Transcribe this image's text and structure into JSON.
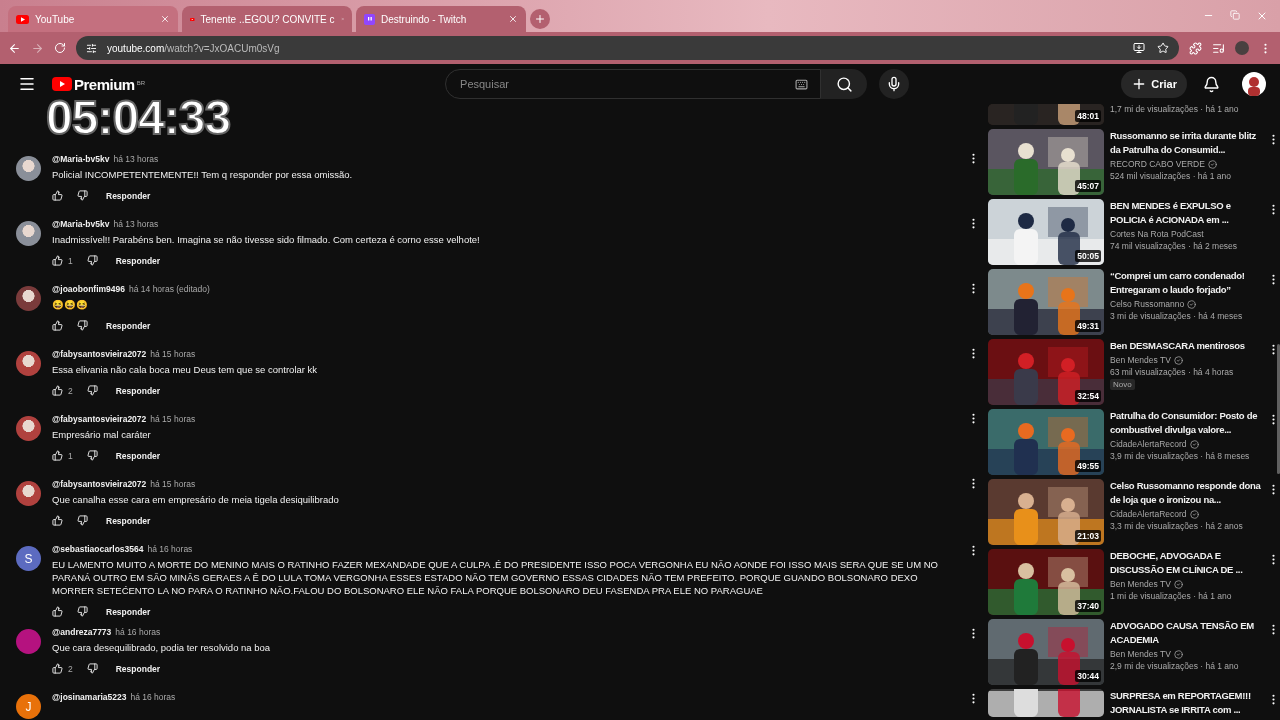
{
  "browser": {
    "tabs": [
      {
        "title": "YouTube",
        "kind": "youtube",
        "selected": true
      },
      {
        "title": "Tenente ..EGOU? CONVITE c",
        "kind": "youtube",
        "selected": false
      },
      {
        "title": "Destruindo - Twitch",
        "kind": "twitch",
        "selected": false
      }
    ],
    "url_host": "youtube.com",
    "url_path": "/watch?v=JxOACUm0sVg"
  },
  "header": {
    "logo": "Premium",
    "region": "BR",
    "search": {
      "placeholder": "Pesquisar"
    },
    "create_label": "Criar"
  },
  "overlay_timer": "05:04:33",
  "comments": [
    {
      "author": "@Maria-bv5kv",
      "time": "há 13 horas",
      "text": "Policial INCOMPETENTEMENTE!! Tem q responder por essa omissão.",
      "reply": "Responder"
    },
    {
      "author": "@Maria-bv5kv",
      "time": "há 13 horas",
      "text": "Inadmissível!! Parabéns ben. Imagina se não tivesse sido filmado. Com certeza é corno esse velhote!",
      "likes": "1",
      "reply": "Responder"
    },
    {
      "author": "@joaobonfim9496",
      "time": "há 14 horas (editado)",
      "text": "😆😆😆",
      "reply": "Responder"
    },
    {
      "author": "@fabysantosvieira2072",
      "time": "há 15 horas",
      "text": "Essa elivania não cala boca meu Deus tem que se controlar kk",
      "likes": "2",
      "reply": "Responder"
    },
    {
      "author": "@fabysantosvieira2072",
      "time": "há 15 horas",
      "text": "Empresário mal caráter",
      "likes": "1",
      "reply": "Responder"
    },
    {
      "author": "@fabysantosvieira2072",
      "time": "há 15 horas",
      "text": "Que canalha esse cara em empresário de meia tigela desiquilibrado",
      "reply": "Responder"
    },
    {
      "author": "@sebastiaocarlos3564",
      "time": "há 16 horas",
      "text": "EU  LAMENTO MUITO A MORTE DO MENINO MAIS O RATINHO FAZER MEXANDADE QUE A CULPA .É DO PRESIDENTE ISSO POCA VERGONHA  EU NÃO AONDE FOI ISSO MAIS SERA QUE SE UM NO PARANÁ OUTRO EM SÃO MINÂS GERAES A Ê DO LULA TOMA VERGONHA ESSES ESTADO  NÃO TEM GOVERNO ESSAS CIDADES NÃO TEM PREFEITO. PORQUE GUANDO BOLSONARO DEXO MORRER SETEĆENTO LA NO PARA O RATINHO NÃO.FALOU DO BOLSONARO ELE NÃO FALA PORQUE BOLSONARO DEU FASENDA PRA ELE NO PARAGUAE",
      "reply": "Responder",
      "avatar": {
        "kind": "letter",
        "letter": "S",
        "color": "#5c6bc0"
      }
    },
    {
      "author": "@andreza7773",
      "time": "há 16 horas",
      "text": "Que cara desequilibrado, podia ter resolvido na boa",
      "likes": "2",
      "reply": "Responder",
      "avatar": {
        "kind": "plain",
        "color": "#b5127f"
      }
    },
    {
      "author": "@josinamaria5223",
      "time": "há 16 horas",
      "avatar": {
        "kind": "letter",
        "letter": "J",
        "color": "#e8710a"
      }
    }
  ],
  "related": [
    {
      "kind": "partial",
      "views": "1,7 mi de visualizações · há 1 ano",
      "duration": "48:01"
    },
    {
      "kind": "video",
      "title": "Russomanno se irrita durante blitz da Patrulha do Consumid...",
      "channel": "RECORD CABO VERDE",
      "verified": true,
      "views": "524 mil visualizações · há 1 ano",
      "duration": "45:07"
    },
    {
      "kind": "video",
      "title": "BEN MENDES é EXPULSO e POLICIA é ACIONADA em ...",
      "channel": "Cortes Na Rota PodCast",
      "verified": false,
      "views": "74 mil visualizações · há 2 meses",
      "duration": "50:05"
    },
    {
      "kind": "video",
      "title": "“Comprei um carro condenado! Entregaram o laudo forjado”",
      "channel": "Celso Russomanno",
      "verified": true,
      "views": "3 mi de visualizações · há 4 meses",
      "duration": "49:31"
    },
    {
      "kind": "video",
      "title": "Ben DESMASCARA mentirosos",
      "channel": "Ben Mendes TV",
      "verified": true,
      "views": "63 mil visualizações · há 4 horas",
      "badge": "Novo",
      "duration": "32:54"
    },
    {
      "kind": "video",
      "title": "Patrulha do Consumidor: Posto de combustível divulga valore...",
      "channel": "CidadeAlertaRecord",
      "verified": true,
      "views": "3,9 mi de visualizações · há 8 meses",
      "duration": "49:55"
    },
    {
      "kind": "video",
      "title": "Celso Russomanno responde dona de loja que o ironizou na...",
      "channel": "CidadeAlertaRecord",
      "verified": true,
      "views": "3,3 mi de visualizações · há 2 anos",
      "duration": "21:03"
    },
    {
      "kind": "video",
      "title": "DEBOCHE, ADVOGADA E DISCUSSÃO EM CLÍNICA DE ...",
      "channel": "Ben Mendes TV",
      "verified": true,
      "views": "1 mi de visualizações · há 1 ano",
      "duration": "37:40"
    },
    {
      "kind": "video",
      "title": "ADVOGADO CAUSA TENSÃO EM ACADEMIA",
      "channel": "Ben Mendes TV",
      "verified": true,
      "views": "2,9 mi de visualizações · há 1 ano",
      "duration": "30:44"
    },
    {
      "kind": "cut",
      "title": "SURPRESA em REPORTAGEM!!! JORNALISTA se IRRITA com ..."
    }
  ]
}
